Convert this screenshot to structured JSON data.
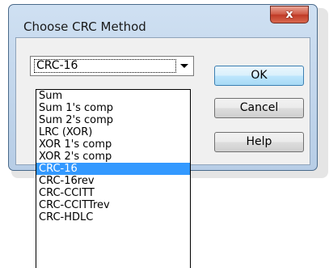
{
  "window": {
    "title": "Choose CRC Method",
    "close_label": "x"
  },
  "combo": {
    "selected_value": "CRC-16",
    "options": [
      "Sum",
      "Sum 1's comp",
      "Sum 2's comp",
      "LRC (XOR)",
      "XOR 1's comp",
      "XOR 2's comp",
      "CRC-16",
      "CRC-16rev",
      "CRC-CCITT",
      "CRC-CCITTrev",
      "CRC-HDLC"
    ],
    "highlighted_index": 6
  },
  "buttons": {
    "ok_label": "OK",
    "cancel_label": "Cancel",
    "help_label": "Help"
  },
  "colors": {
    "selection": "#3399ff",
    "close_button": "#c8422f"
  }
}
